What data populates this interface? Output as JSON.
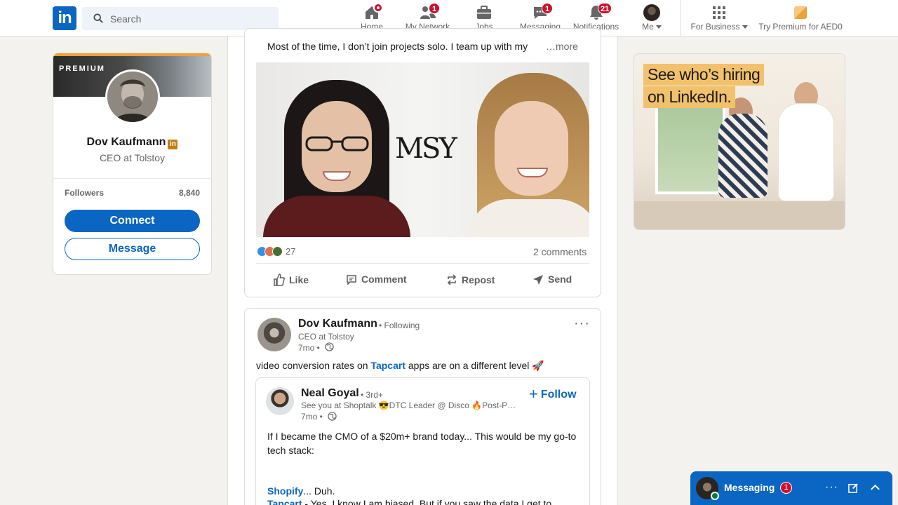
{
  "nav": {
    "search_placeholder": "Search",
    "items": [
      {
        "label": "Home",
        "badge": ""
      },
      {
        "label": "My Network",
        "badge": "1"
      },
      {
        "label": "Jobs",
        "badge": ""
      },
      {
        "label": "Messaging",
        "badge": "1"
      },
      {
        "label": "Notifications",
        "badge": "21"
      },
      {
        "label": "Me",
        "badge": ""
      }
    ],
    "for_business": "For Business",
    "try_premium": "Try Premium for AED0"
  },
  "profile_card": {
    "premium_label": "PREMIUM",
    "name": "Dov Kaufmann",
    "title": "CEO at Tolstoy",
    "followers_label": "Followers",
    "followers_count": "8,840",
    "connect_label": "Connect",
    "message_label": "Message"
  },
  "post1": {
    "text": "Most of the time, I don’t join projects solo. I team up with my",
    "more_label": "…more",
    "image_logo": "MSY",
    "reaction_count": "27",
    "comments_label": "2 comments",
    "actions": [
      "Like",
      "Comment",
      "Repost",
      "Send"
    ]
  },
  "post2": {
    "author": "Dov Kaufmann",
    "following": "• Following",
    "author_title": "CEO at Tolstoy",
    "time": "7mo •",
    "text_before": "video conversion rates on ",
    "tag": "Tapcart",
    "text_after": " apps are on a different level 🚀",
    "menu": "···",
    "shared": {
      "author": "Neal Goyal",
      "degree": "• 3rd+",
      "headline": "See you at Shoptalk 😎DTC Leader @ Disco 🔥Post-P…",
      "time": "7mo •",
      "follow_label": "Follow",
      "body": "If I became the CMO of a $20m+ brand today... This would be my go-to tech stack:",
      "line2_link": "Shopify",
      "line2_rest": "... Duh.",
      "line3_link": "Tapcart",
      "line3_rest": " - Yes, I know I am biased. But if you saw the data I get to"
    }
  },
  "ad": {
    "headline_1": "See who’s hiring",
    "headline_2": "on LinkedIn."
  },
  "messaging": {
    "label": "Messaging",
    "badge": "1"
  },
  "colors": {
    "brand_blue": "#0a66c2",
    "badge_red": "#cb112d",
    "premium_gold": "#c37d16"
  }
}
